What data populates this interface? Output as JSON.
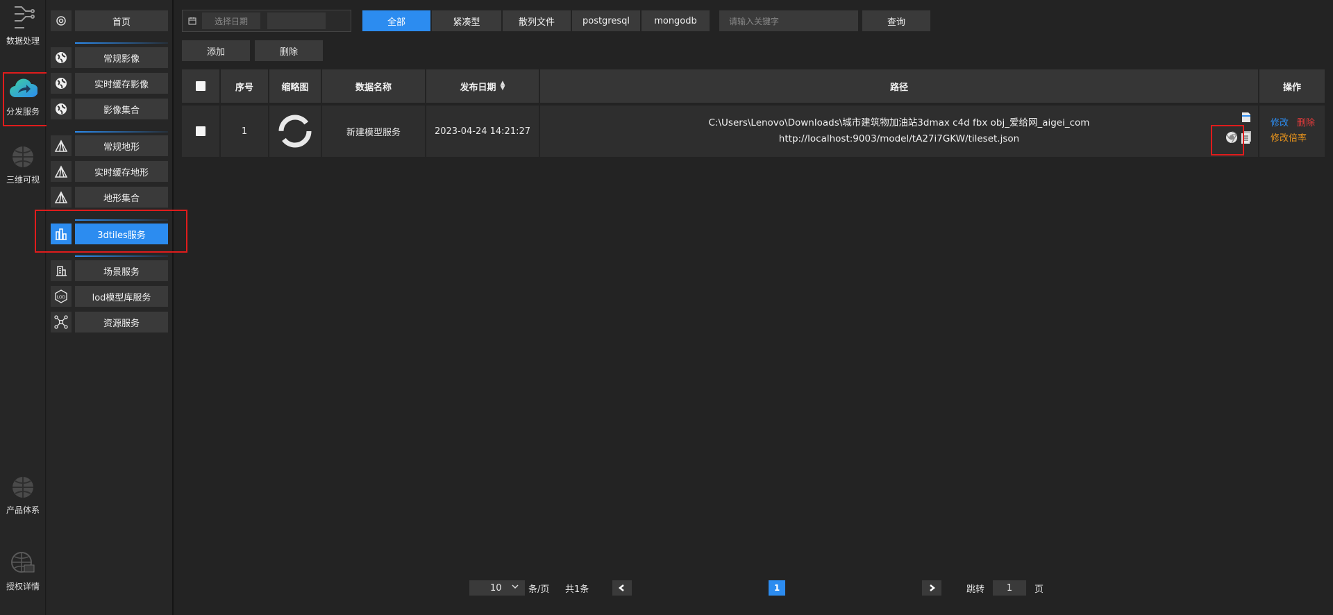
{
  "rail": {
    "items": [
      {
        "label": "数据处理",
        "icon": "data-process-icon"
      },
      {
        "label": "分发服务",
        "icon": "cloud-share-icon"
      },
      {
        "label": "三维可视",
        "icon": "globe-3d-icon"
      },
      {
        "label": "产品体系",
        "icon": "globe-product-icon"
      },
      {
        "label": "授权详情",
        "icon": "license-globe-icon"
      }
    ]
  },
  "menu": {
    "home": "首页",
    "imagery": [
      "常规影像",
      "实时缓存影像",
      "影像集合"
    ],
    "terrain": [
      "常规地形",
      "实时缓存地形",
      "地形集合"
    ],
    "tiles": "3dtiles服务",
    "others": [
      "场景服务",
      "lod模型库服务",
      "资源服务"
    ]
  },
  "filters": {
    "date_placeholder": "选择日期",
    "tabs": [
      "全部",
      "紧凑型",
      "散列文件",
      "postgresql",
      "mongodb"
    ],
    "active_tab": "全部",
    "search_placeholder": "请输入关键字",
    "query_label": "查询"
  },
  "actions": {
    "add": "添加",
    "delete": "删除"
  },
  "table": {
    "headers": {
      "index": "序号",
      "thumbnail": "缩略图",
      "name": "数据名称",
      "date": "发布日期",
      "path": "路径",
      "ops": "操作"
    },
    "rows": [
      {
        "index": "1",
        "name": "新建模型服务",
        "date": "2023-04-24 14:21:27",
        "path_local": "C:\\Users\\Lenovo\\Downloads\\城市建筑物加油站3dmax c4d fbx obj_爱给网_aigei_com",
        "path_url": "http://localhost:9003/model/tA27i7GKW/tileset.json",
        "op_edit": "修改",
        "op_delete": "删除",
        "op_rate": "修改倍率"
      }
    ]
  },
  "pager": {
    "page_size": "10",
    "page_unit": "条/页",
    "total": "共1条",
    "current_page": "1",
    "jump_label": "跳转",
    "jump_value": "1",
    "jump_unit": "页"
  },
  "colors": {
    "accent": "#2c8cf0",
    "highlight": "#e01c1c",
    "danger": "#e83b3b",
    "warning": "#e8941c"
  }
}
